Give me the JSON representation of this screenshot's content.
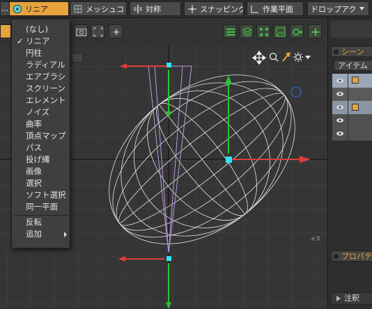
{
  "toolbar": {
    "left_dots": "…",
    "linear_label": "リニア",
    "mesh_label": "メッシュコ",
    "symmetry_label": "対称",
    "snapping_label": "スナッピング",
    "workplane_label": "作業平面",
    "dropdown_label": "ドロップアク"
  },
  "menu": {
    "items": [
      {
        "label": "(なし)"
      },
      {
        "label": "リニア",
        "checked": true
      },
      {
        "label": "円柱"
      },
      {
        "label": "ラディアル"
      },
      {
        "label": "エアブラシ"
      },
      {
        "label": "スクリーン"
      },
      {
        "label": "エレメント"
      },
      {
        "label": "ノイズ"
      },
      {
        "label": "曲率"
      },
      {
        "label": "頂点マップ"
      },
      {
        "label": "パス"
      },
      {
        "label": "投げ縄"
      },
      {
        "label": "画像"
      },
      {
        "label": "選択"
      },
      {
        "label": "ソフト選択"
      },
      {
        "label": "同一平面"
      }
    ],
    "invert_label": "反転",
    "add_label": "追加",
    "check_mark": "✓"
  },
  "right_panel": {
    "scene_tab": "シーン",
    "items_tab": "アイテム",
    "properties_tab": "プロパテ",
    "notes_label": "注釈"
  },
  "viewport": {
    "axis_label": "+X"
  },
  "colors": {
    "accent": "#e8a33d",
    "axis_red": "#e23b3b",
    "axis_green": "#2ec22e",
    "handle_cyan": "#2ee6f0",
    "falloff_purple": "#b79adf"
  }
}
